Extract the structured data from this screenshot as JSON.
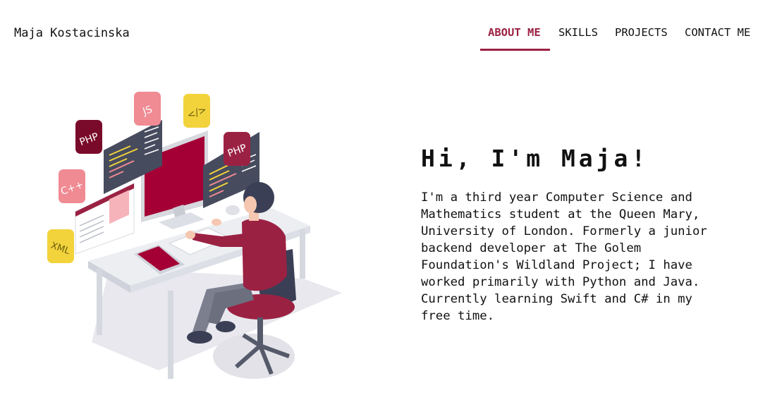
{
  "header": {
    "brand": "Maja Kostacinska",
    "nav": [
      {
        "label": "ABOUT ME",
        "active": true
      },
      {
        "label": "SKILLS",
        "active": false
      },
      {
        "label": "PROJECTS",
        "active": false
      },
      {
        "label": "CONTACT ME",
        "active": false
      }
    ]
  },
  "hero": {
    "title": "Hi, I'm Maja!",
    "bio_lines": [
      "I'm a third year Computer Science and",
      "Mathematics student at the Queen Mary,",
      "University of London. Formerly a junior",
      "backend developer at The Golem",
      "Foundation's Wildland Project; I have",
      "worked primarily with Python and Java.",
      "Currently learning Swift and C# in my",
      "free time."
    ],
    "illustration": {
      "badges": [
        "PHP",
        "JS",
        "</>",
        "PHP",
        "C++",
        "XML"
      ]
    }
  },
  "colors": {
    "accent": "#9b2143",
    "dark": "#3a3f55",
    "pink": "#f08a93",
    "yellow": "#f2d33b"
  }
}
